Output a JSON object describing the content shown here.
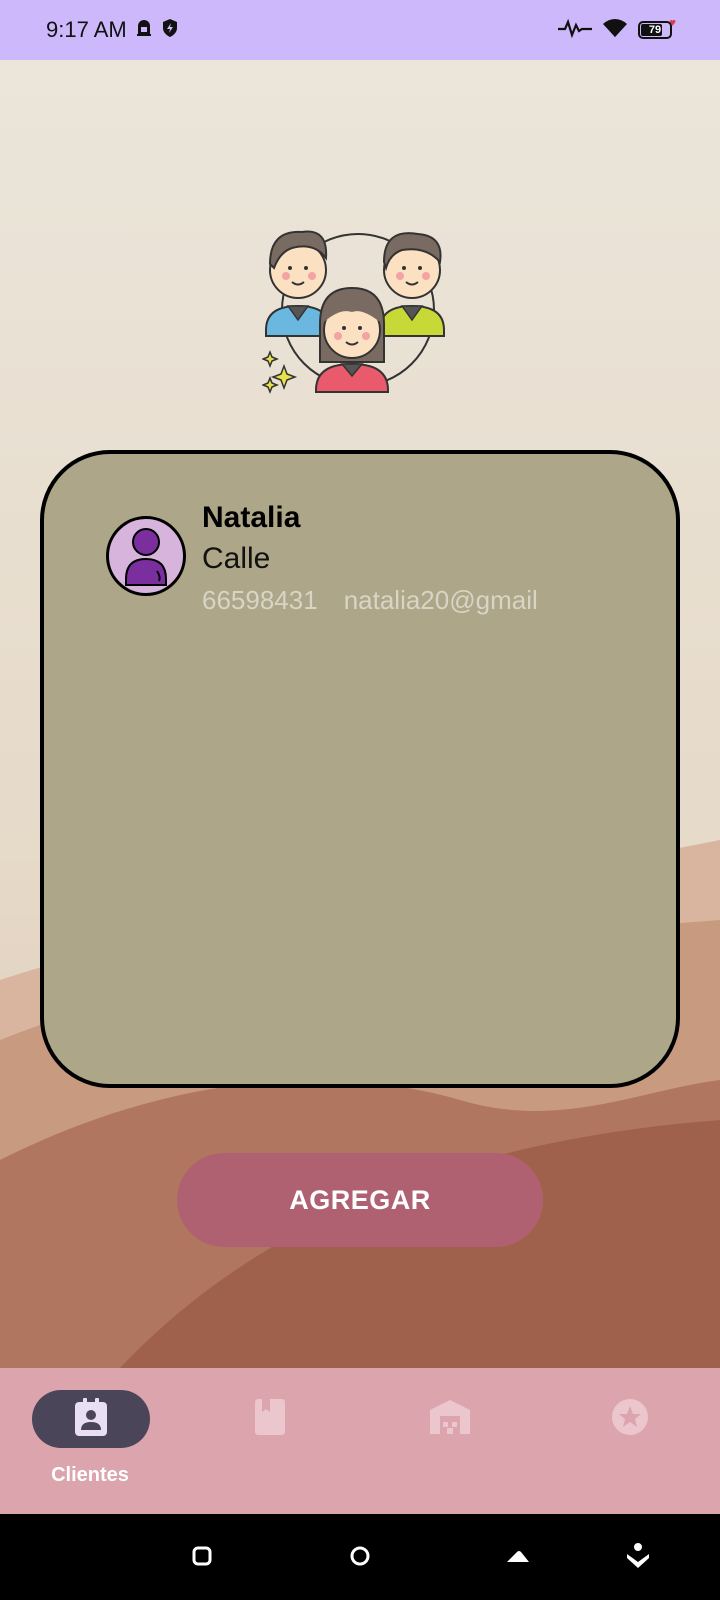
{
  "status_bar": {
    "time": "9:17 AM",
    "battery_level": "79",
    "background_color": "#cdb8fb",
    "icons": [
      "alarm-icon",
      "shield-icon",
      "activity-icon",
      "wifi-icon",
      "battery-icon"
    ]
  },
  "illustration": {
    "icon": "group-of-people-icon"
  },
  "client_list": {
    "items": [
      {
        "name": "Natalia",
        "address": "Calle",
        "phone": "66598431",
        "email": "natalia20@gmail",
        "avatar_icon": "person-icon"
      }
    ]
  },
  "actions": {
    "add_label": "AGREGAR",
    "button_color": "#af6172"
  },
  "bottom_nav": {
    "background_color": "#dca4ad",
    "items": [
      {
        "label": "Clientes",
        "icon": "contacts-icon",
        "active": true
      },
      {
        "label": "",
        "icon": "book-icon",
        "active": false
      },
      {
        "label": "",
        "icon": "warehouse-icon",
        "active": false
      },
      {
        "label": "",
        "icon": "star-icon",
        "active": false
      }
    ]
  },
  "system_nav": {
    "icons": [
      "recents-icon",
      "home-icon",
      "back-icon",
      "assistant-icon"
    ]
  }
}
